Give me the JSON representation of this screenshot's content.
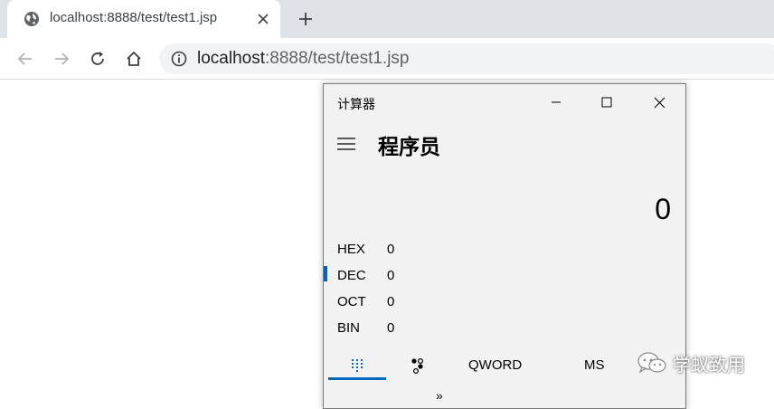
{
  "browser": {
    "tab": {
      "title": "localhost:8888/test/test1.jsp",
      "favicon": "globe-icon"
    },
    "address_bar": {
      "host": "localhost",
      "path": ":8888/test/test1.jsp"
    }
  },
  "calculator": {
    "window_title": "计算器",
    "mode_title": "程序员",
    "display_value": "0",
    "radix": [
      {
        "label": "HEX",
        "value": "0"
      },
      {
        "label": "DEC",
        "value": "0",
        "selected": true
      },
      {
        "label": "OCT",
        "value": "0"
      },
      {
        "label": "BIN",
        "value": "0"
      }
    ],
    "word_size": "QWORD",
    "memory_store": "MS",
    "more": "»",
    "accent_color": "#0067c0"
  },
  "watermark": {
    "text": "学蚁致用"
  }
}
